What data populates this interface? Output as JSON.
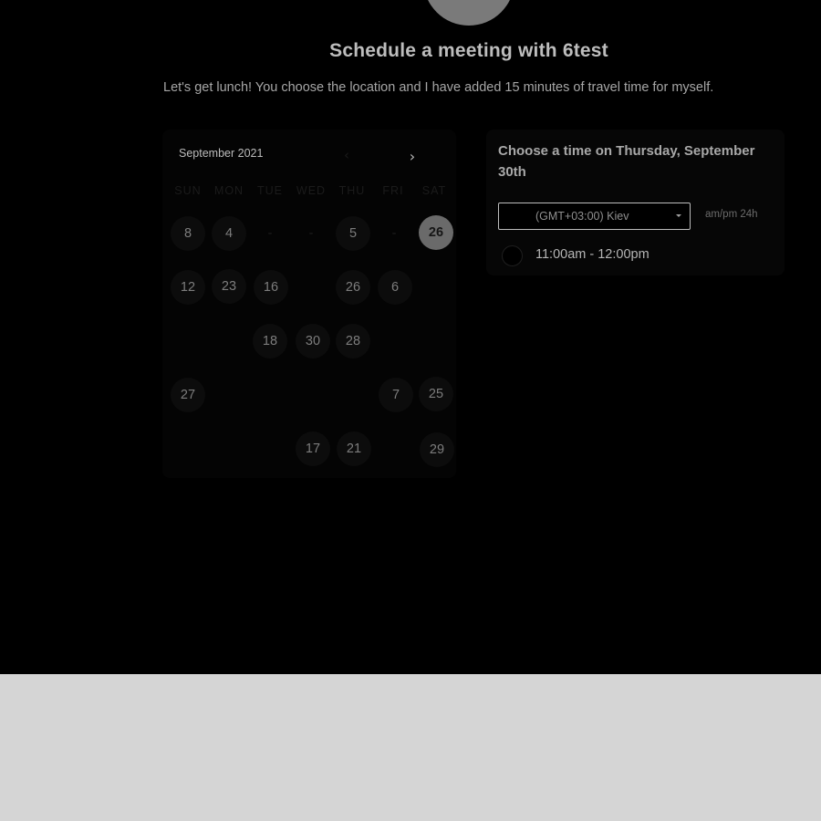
{
  "header": {
    "title": "Schedule a meeting with 6test",
    "subtitle": "Let's get lunch! You choose the location and I have added 15 minutes of travel time for myself."
  },
  "calendar": {
    "month_label": "September 2021",
    "prev_icon": "chevron-left-icon",
    "next_icon": "chevron-right-icon",
    "prev_glyph": "‹",
    "next_glyph": "›",
    "weekdays": [
      "SUN",
      "MON",
      "TUE",
      "WED",
      "THU",
      "FRI",
      "SAT"
    ],
    "selected_day": "26",
    "days": [
      [
        "8",
        "4",
        "-",
        "-",
        "5",
        "-",
        "26"
      ],
      [
        "12",
        "23",
        "16",
        "",
        "26",
        "6",
        ""
      ],
      [
        "",
        "",
        "18",
        "30",
        "28",
        "",
        ""
      ],
      [
        "27",
        "",
        "",
        "",
        "",
        "7",
        "25"
      ],
      [
        "",
        "",
        "",
        "17",
        "21",
        "",
        "29"
      ]
    ]
  },
  "time_panel": {
    "heading": "Choose a time on Thursday, September 30th",
    "timezone": "(GMT+03:00) Kiev",
    "time_format": "am/pm  24h",
    "slots": [
      {
        "label": "11:00am - 12:00pm",
        "selected": false
      }
    ]
  },
  "colors": {
    "background": "#000000",
    "footer": "#d5d5d5",
    "selected_day": "#6a6a6a"
  }
}
